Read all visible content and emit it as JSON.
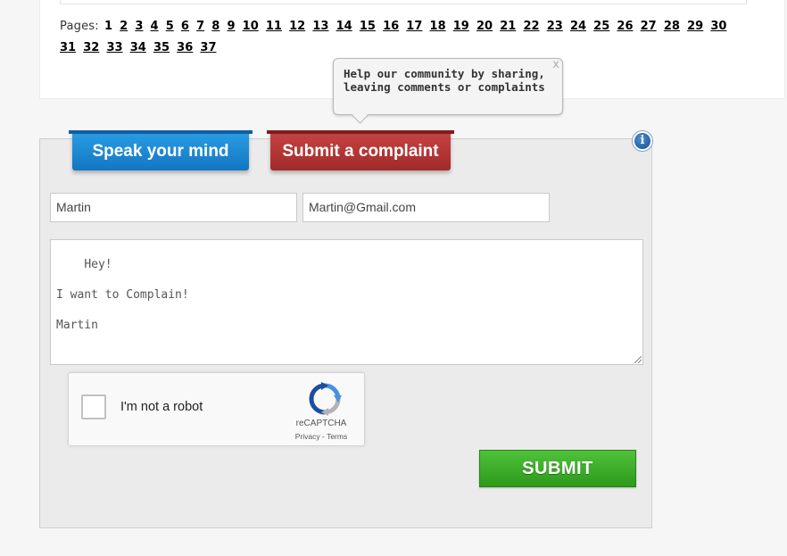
{
  "pager": {
    "label": "Pages:",
    "current": "1",
    "pages": [
      "2",
      "3",
      "4",
      "5",
      "6",
      "7",
      "8",
      "9",
      "10",
      "11",
      "12",
      "13",
      "14",
      "15",
      "16",
      "17",
      "18",
      "19",
      "20",
      "21",
      "22",
      "23",
      "24",
      "25",
      "26",
      "27",
      "28",
      "29",
      "30",
      "31",
      "32",
      "33",
      "34",
      "35",
      "36",
      "37"
    ]
  },
  "tooltip": {
    "text": "Help our community by sharing, leaving comments or complaints",
    "close": "x"
  },
  "tabs": {
    "speak": "Speak your mind",
    "complaint": "Submit a complaint"
  },
  "info_icon": "i",
  "form": {
    "name_value": "Martin",
    "email_value": "Martin@Gmail.com",
    "message_value": "Hey!\n\nI want to Complain!\n\nMartin"
  },
  "captcha": {
    "label": "I'm not a robot",
    "brand": "reCAPTCHA",
    "privacy": "Privacy",
    "separator": " - ",
    "terms": "Terms"
  },
  "submit_label": "SUBMIT",
  "colors": {
    "speak_tab": "#1a86d4",
    "complaint_tab": "#b53636",
    "submit": "#3bae27"
  },
  "icons": {
    "info": "info-icon",
    "close": "close-icon",
    "recaptcha": "recaptcha-logo-icon"
  }
}
